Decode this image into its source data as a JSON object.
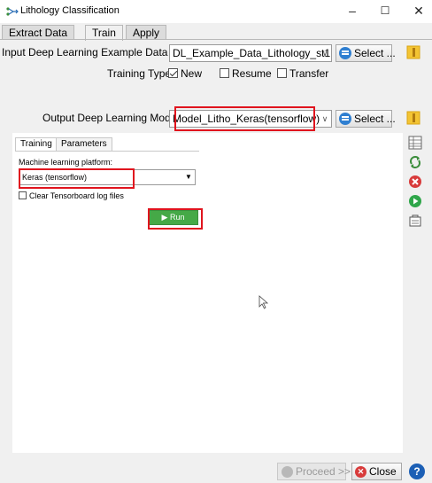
{
  "window": {
    "title": "Lithology Classification",
    "minimize": "–",
    "maximize": "☐",
    "close": "✕"
  },
  "tabs": [
    {
      "label": "Extract Data",
      "active": false
    },
    {
      "label": "Train",
      "active": true
    },
    {
      "label": "Apply",
      "active": false
    }
  ],
  "input_example": {
    "label": "Input Deep Learning Example Data",
    "value": "DL_Example_Data_Lithology_st1",
    "select_label": "Select ..."
  },
  "training_type": {
    "label": "Training Type",
    "options": [
      {
        "label": "New",
        "checked": true
      },
      {
        "label": "Resume",
        "checked": false
      },
      {
        "label": "Transfer",
        "checked": false
      }
    ]
  },
  "output_model": {
    "label": "Output Deep Learning Model",
    "value": "Model_Litho_Keras(tensorflow)",
    "select_label": "Select ..."
  },
  "panel": {
    "tabs": [
      {
        "label": "Training",
        "active": true
      },
      {
        "label": "Parameters",
        "active": false
      }
    ],
    "platform_label": "Machine learning platform:",
    "platform_value": "Keras (tensorflow)",
    "clear_logs_label": "Clear Tensorboard log files",
    "clear_logs_checked": false,
    "run_label": "▶ Run"
  },
  "side_tools": [
    "table-icon",
    "refresh-icon",
    "cancel-icon",
    "play-icon",
    "export-icon"
  ],
  "footer": {
    "proceed_label": "Proceed >>",
    "close_label": "Close",
    "help_label": "?"
  },
  "colors": {
    "highlight": "#e0141e",
    "run_button": "#45a947",
    "select_icon": "#2f7fd1",
    "close_icon": "#d83b3b",
    "help_icon": "#1c5fb5"
  }
}
